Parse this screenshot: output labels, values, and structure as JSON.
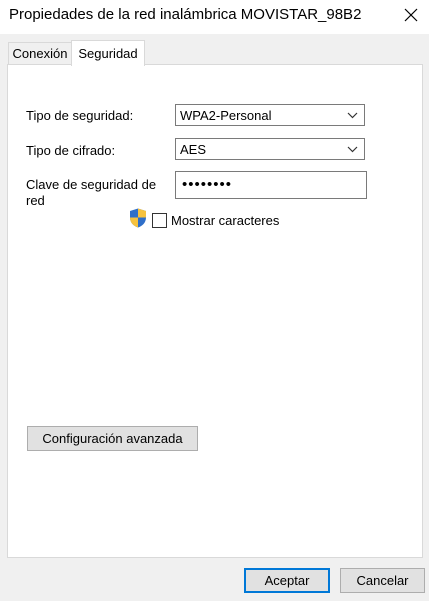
{
  "window": {
    "title": "Propiedades de la red inalámbrica MOVISTAR_98B2",
    "close_icon": "close-icon"
  },
  "tabs": [
    {
      "label": "Conexión",
      "active": false
    },
    {
      "label": "Seguridad",
      "active": true
    }
  ],
  "security": {
    "type_label": "Tipo de seguridad:",
    "type_value": "WPA2-Personal",
    "encryption_label": "Tipo de cifrado:",
    "encryption_value": "AES",
    "key_label": "Clave de seguridad de red",
    "key_masked": "••••••••",
    "show_chars_label": "Mostrar caracteres",
    "show_chars_checked": false
  },
  "buttons": {
    "advanced": "Configuración avanzada",
    "ok": "Aceptar",
    "cancel": "Cancelar"
  },
  "colors": {
    "accent": "#0078d7",
    "window_bg": "#f0f0f0",
    "panel_bg": "#ffffff"
  }
}
